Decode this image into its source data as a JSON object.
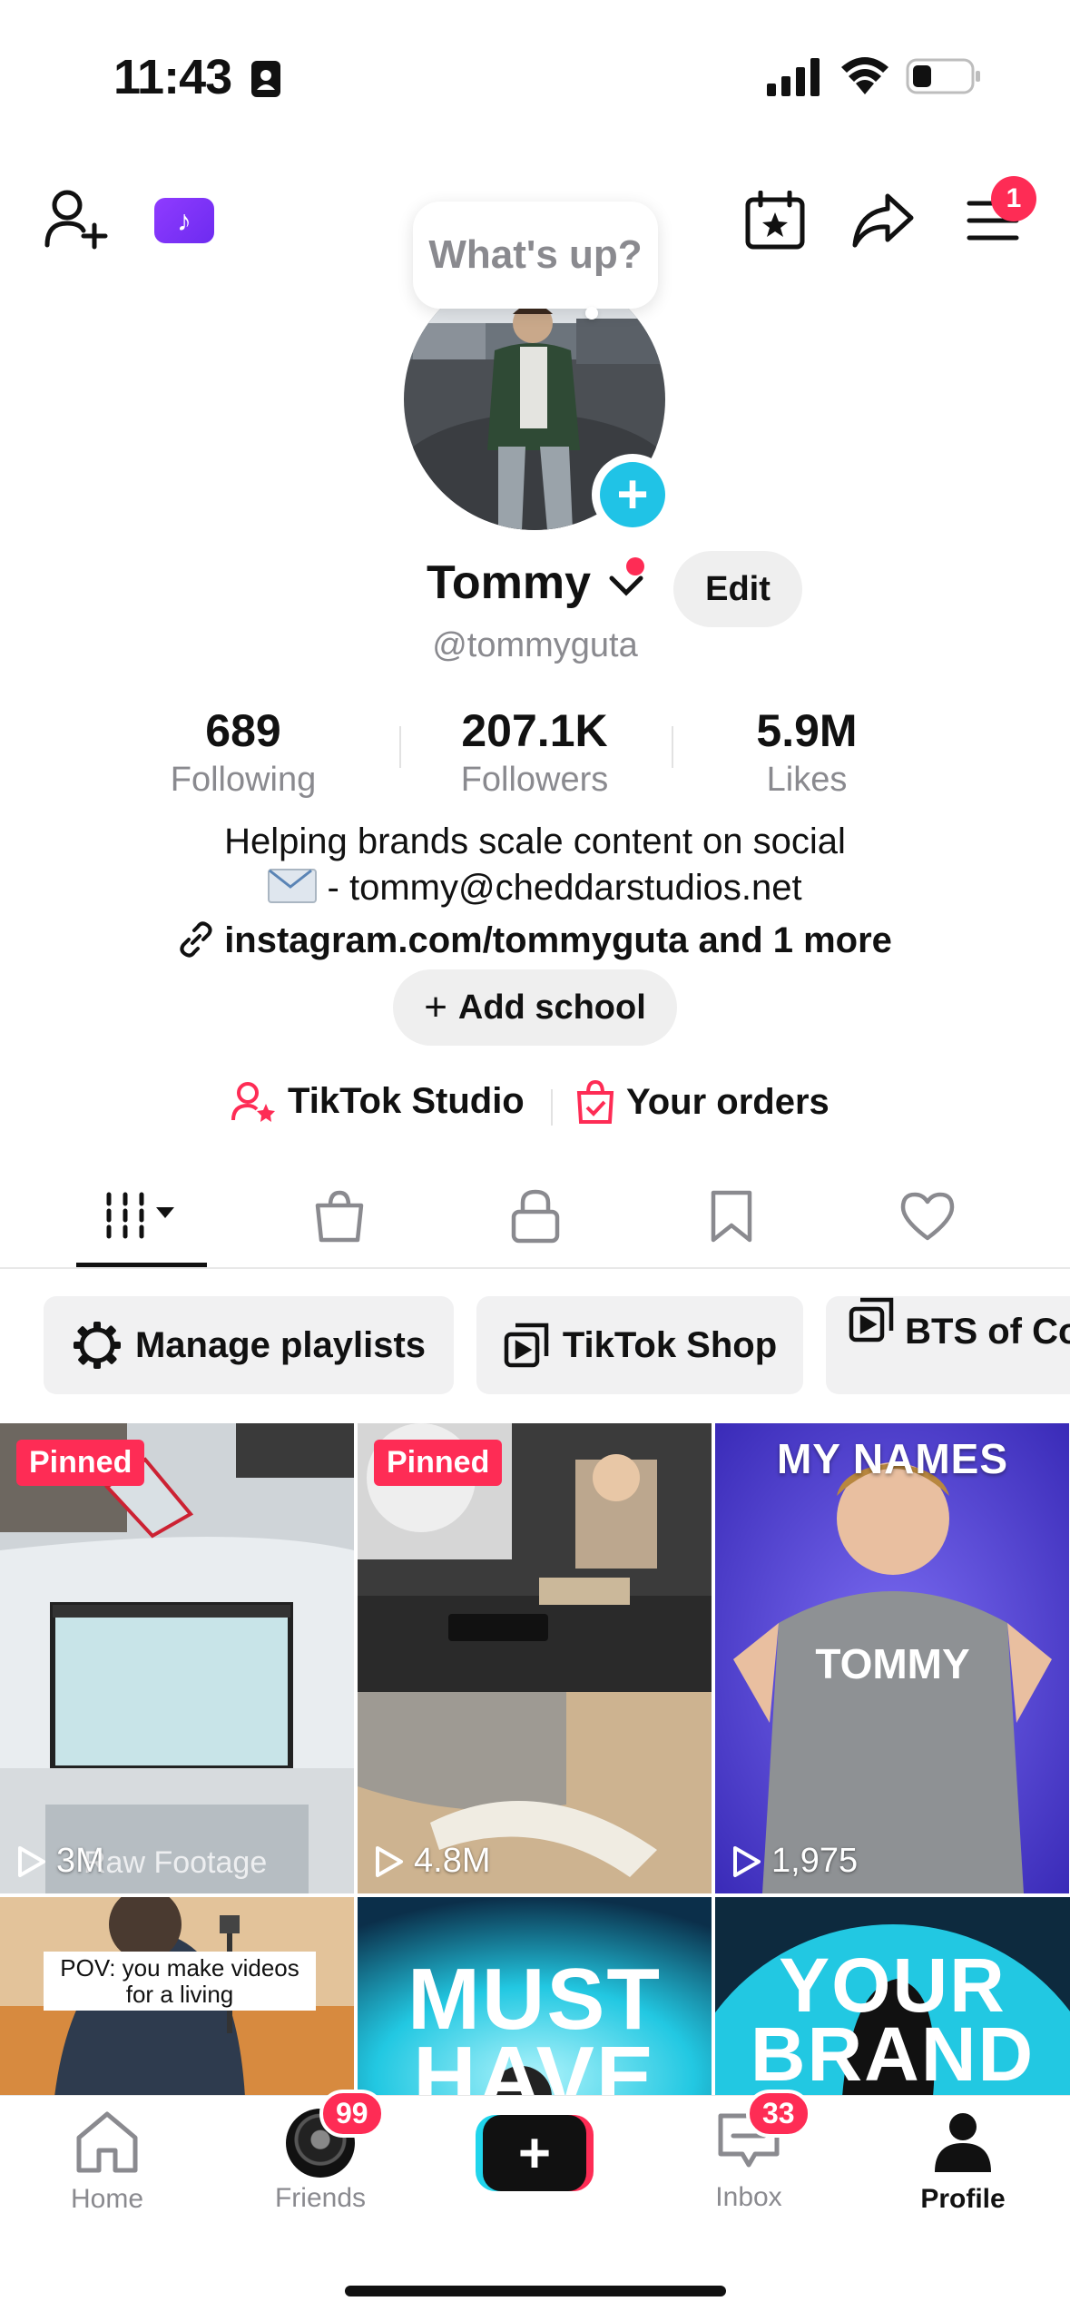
{
  "status_bar": {
    "time": "11:43"
  },
  "header": {
    "bubble_text": "What's up?",
    "menu_badge": "1"
  },
  "profile": {
    "name": "Tommy",
    "edit_label": "Edit",
    "handle": "@tommyguta",
    "stats": [
      {
        "value": "689",
        "label": "Following"
      },
      {
        "value": "207.1K",
        "label": "Followers"
      },
      {
        "value": "5.9M",
        "label": "Likes"
      }
    ],
    "bio_line1": "Helping brands scale content on social",
    "bio_line2": "- tommy@cheddarstudios.net",
    "link": "instagram.com/tommyguta",
    "link_more": "and 1 more",
    "add_school": "Add school",
    "studio": "TikTok Studio",
    "orders": "Your orders"
  },
  "playlists": [
    "Manage playlists",
    "TikTok Shop",
    "BTS of Co"
  ],
  "videos": [
    {
      "pinned": "Pinned",
      "views": "3M",
      "caption": "Raw Footage"
    },
    {
      "pinned": "Pinned",
      "views": "4.8M"
    },
    {
      "views": "1,975",
      "overlay_top": "MY NAMES",
      "overlay_mid": "TOMMY"
    },
    {
      "overlay": "POV: you make videos for a living"
    },
    {
      "overlay": "MUST HAVE"
    },
    {
      "overlay": "YOUR BRAND"
    }
  ],
  "nav": {
    "home": "Home",
    "friends": "Friends",
    "friends_badge": "99",
    "inbox": "Inbox",
    "inbox_badge": "33",
    "profile": "Profile"
  },
  "colors": {
    "accent": "#fe2c55",
    "cyan": "#20c3e6"
  }
}
